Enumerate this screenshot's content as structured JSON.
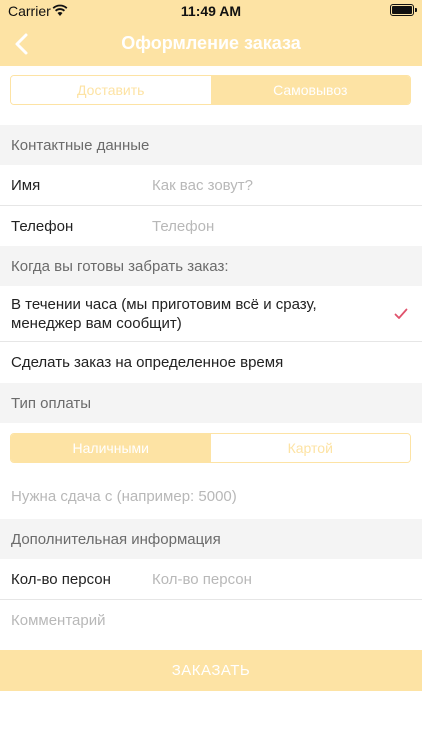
{
  "status_bar": {
    "carrier": "Carrier",
    "time": "11:49 AM"
  },
  "nav": {
    "title": "Оформление заказа"
  },
  "delivery_segment": {
    "options": [
      "Доставить",
      "Самовывоз"
    ],
    "selected": "Самовывоз"
  },
  "contact": {
    "header": "Контактные данные",
    "name_label": "Имя",
    "name_placeholder": "Как вас зовут?",
    "phone_label": "Телефон",
    "phone_placeholder": "Телефон"
  },
  "pickup_time": {
    "header": "Когда вы готовы забрать заказ:",
    "options": [
      {
        "label": "В течении часа (мы приготовим всё и сразу, менеджер вам сообщит)",
        "checked": true
      },
      {
        "label": "Сделать заказ на определенное время",
        "checked": false
      }
    ]
  },
  "payment": {
    "header": "Тип оплаты",
    "options": [
      "Наличными",
      "Картой"
    ],
    "selected": "Наличными",
    "change_placeholder": "Нужна сдача с (например: 5000)"
  },
  "additional": {
    "header": "Дополнительная информация",
    "persons_label": "Кол-во персон",
    "persons_placeholder": "Кол-во персон",
    "comment_placeholder": "Комментарий"
  },
  "order_button": {
    "label": "ЗАКАЗАТЬ"
  },
  "colors": {
    "accent": "#fde3a4",
    "checkmark": "#e0526c",
    "section_bg": "#f4f4f4"
  }
}
